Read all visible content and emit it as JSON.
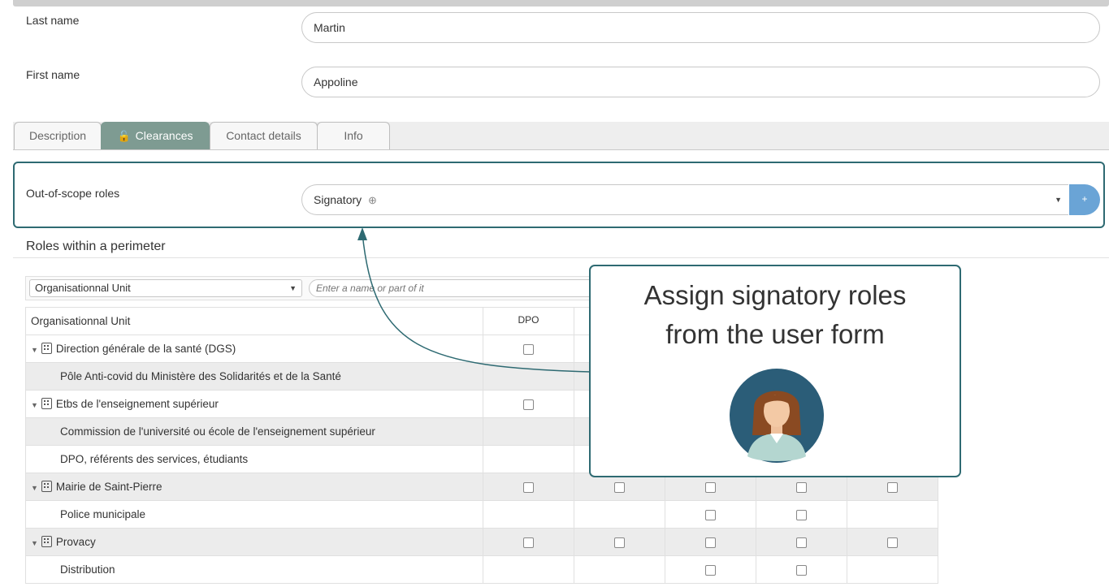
{
  "form": {
    "last_name_label": "Last name",
    "last_name_value": "Martin",
    "first_name_label": "First name",
    "first_name_value": "Appoline"
  },
  "tabs": [
    {
      "label": "Description",
      "active": false
    },
    {
      "label": "Clearances",
      "active": true,
      "icon": "lock-open-icon"
    },
    {
      "label": "Contact details",
      "active": false
    },
    {
      "label": "Info",
      "active": false
    }
  ],
  "scope": {
    "label": "Out-of-scope roles",
    "selected": "Signatory",
    "pin_icon": "⊕",
    "add_label": "+"
  },
  "perimeter": {
    "title": "Roles within a perimeter",
    "filter_select": "Organisationnal Unit",
    "search_placeholder": "Enter a name or part of it",
    "column_header": "Organisationnal Unit",
    "role_columns": [
      "DPO",
      "",
      "",
      "",
      ""
    ],
    "rows": [
      {
        "name": "Direction générale de la santé (DGS)",
        "type": "org",
        "shade": false,
        "checks": [
          true,
          false,
          false,
          false,
          false
        ]
      },
      {
        "name": "Pôle Anti-covid du Ministère des Solidarités et de la Santé",
        "type": "child",
        "shade": true,
        "checks": [
          false,
          false,
          false,
          false,
          false
        ]
      },
      {
        "name": "Etbs de l'enseignement supérieur",
        "type": "org",
        "shade": false,
        "checks": [
          true,
          false,
          false,
          false,
          false
        ]
      },
      {
        "name": "Commission de l'université ou école de l'enseignement supérieur",
        "type": "child",
        "shade": true,
        "checks": [
          false,
          false,
          false,
          false,
          false
        ]
      },
      {
        "name": "DPO, référents des services, étudiants",
        "type": "child",
        "shade": false,
        "checks": [
          false,
          false,
          false,
          false,
          false
        ]
      },
      {
        "name": "Mairie de Saint-Pierre",
        "type": "org",
        "shade": true,
        "checks": [
          true,
          true,
          true,
          true,
          true
        ]
      },
      {
        "name": "Police municipale",
        "type": "child",
        "shade": false,
        "checks": [
          false,
          false,
          true,
          true,
          false
        ]
      },
      {
        "name": "Provacy",
        "type": "org",
        "shade": true,
        "checks": [
          true,
          true,
          true,
          true,
          true
        ]
      },
      {
        "name": "Distribution",
        "type": "child",
        "shade": false,
        "checks": [
          false,
          false,
          true,
          true,
          false
        ]
      }
    ]
  },
  "callout": {
    "text": "Assign signatory roles\nfrom the user form",
    "avatar_icon": "woman-avatar-icon"
  },
  "colors": {
    "accent_teal": "#2e6a72",
    "tab_active": "#7e9b92",
    "add_button": "#6aa4d6"
  }
}
